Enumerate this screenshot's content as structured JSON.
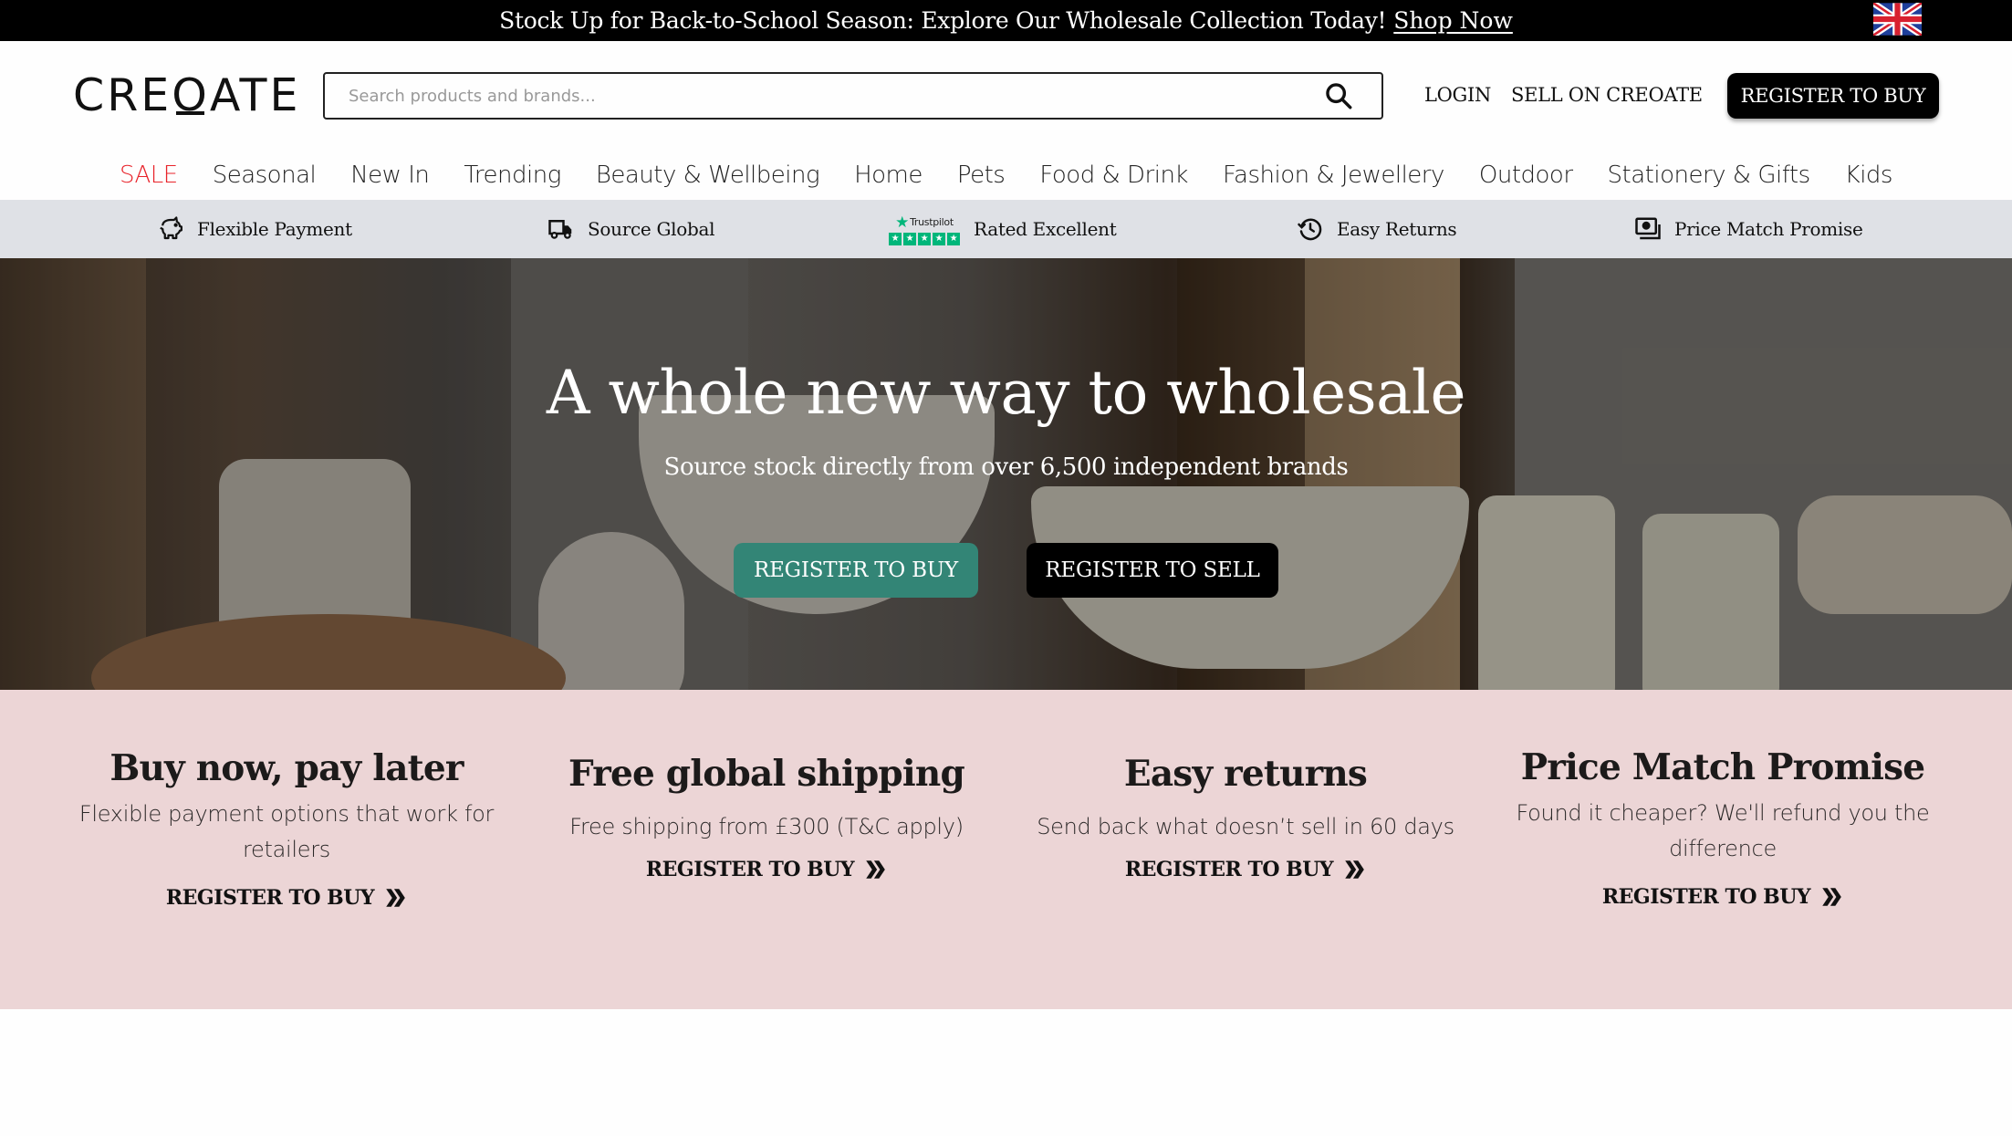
{
  "announcement": {
    "message": "Stock Up for Back-to-School Season: Explore Our Wholesale Collection Today!",
    "link_label": "Shop Now",
    "region_flag": "uk-flag-icon"
  },
  "header": {
    "logo": {
      "pre": "CRE",
      "o": "O",
      "post": "ATE"
    },
    "search": {
      "placeholder": "Search products and brands...",
      "value": "",
      "icon": "search-icon"
    },
    "login_label": "LOGIN",
    "sell_label": "SELL ON CREOATE",
    "register_label": "REGISTER TO BUY"
  },
  "categories": [
    {
      "label": "SALE",
      "highlight": true
    },
    {
      "label": "Seasonal"
    },
    {
      "label": "New In"
    },
    {
      "label": "Trending"
    },
    {
      "label": "Beauty & Wellbeing"
    },
    {
      "label": "Home"
    },
    {
      "label": "Pets"
    },
    {
      "label": "Food & Drink"
    },
    {
      "label": "Fashion & Jewellery"
    },
    {
      "label": "Outdoor"
    },
    {
      "label": "Stationery & Gifts"
    },
    {
      "label": "Kids"
    }
  ],
  "benefits": [
    {
      "icon": "piggy-bank-icon",
      "label": "Flexible Payment"
    },
    {
      "icon": "truck-icon",
      "label": "Source Global"
    },
    {
      "icon": "trustpilot-logo",
      "label": "Rated Excellent",
      "badge_text": "Trustpilot"
    },
    {
      "icon": "history-icon",
      "label": "Easy Returns"
    },
    {
      "icon": "price-tag-icon",
      "label": "Price Match Promise"
    }
  ],
  "hero": {
    "title": "A whole new way to wholesale",
    "subtitle": "Source stock directly from over 6,500 independent brands",
    "buy_label": "REGISTER TO BUY",
    "sell_label": "REGISTER TO SELL",
    "colors": {
      "buy": "#338576",
      "sell": "#000000"
    }
  },
  "features": [
    {
      "title": "Buy now, pay later",
      "text": "Flexible payment options that work for retailers",
      "cta": "REGISTER TO BUY"
    },
    {
      "title": "Free global shipping",
      "text": "Free shipping from £300 (T&C apply)",
      "cta": "REGISTER TO BUY"
    },
    {
      "title": "Easy returns",
      "text": "Send back what doesn’t sell in 60 days",
      "cta": "REGISTER TO BUY"
    },
    {
      "title": "Price Match Promise",
      "text": "Found it cheaper? We'll refund you the difference",
      "cta": "REGISTER TO BUY"
    }
  ],
  "colors": {
    "sale": "#e8232a",
    "features_bg": "#ecd5d6",
    "strip_bg": "#dfe1e6",
    "trustpilot": "#00b67a"
  }
}
